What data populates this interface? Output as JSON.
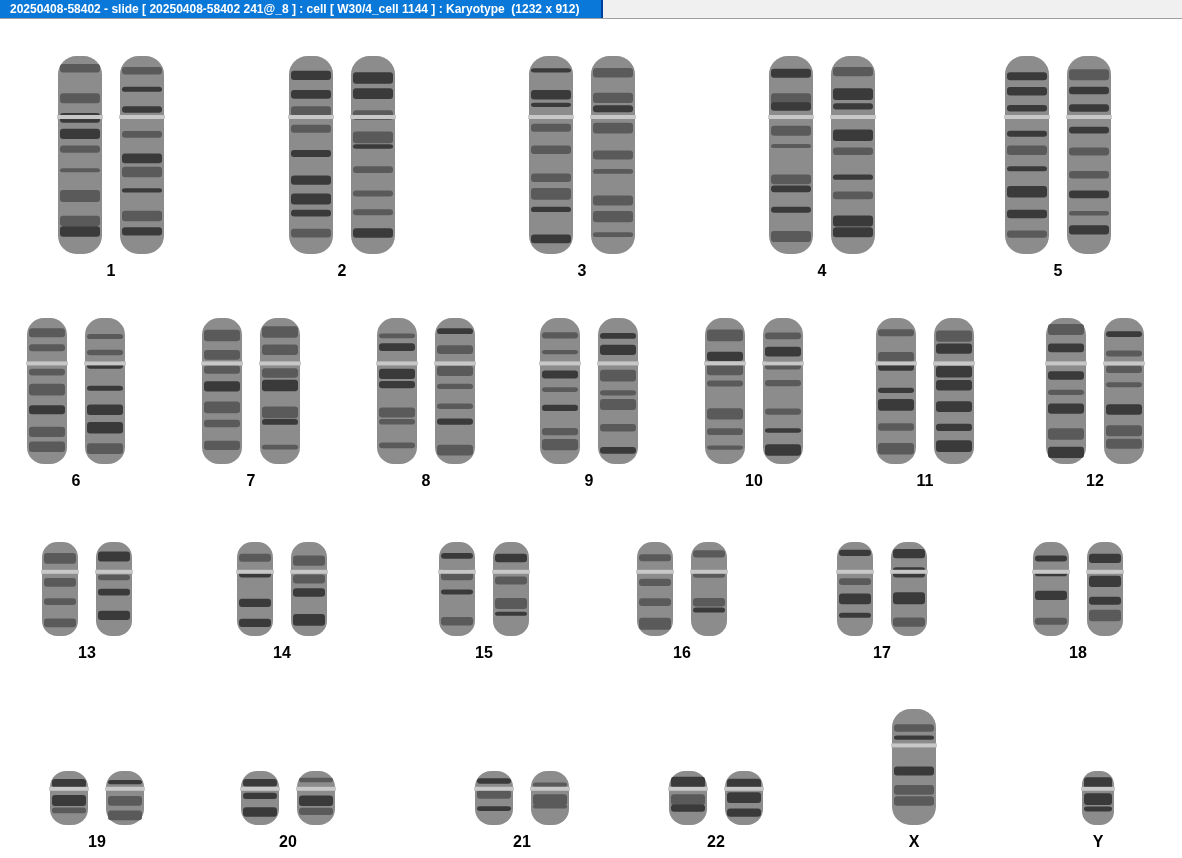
{
  "window": {
    "title": "20250408-58402 - slide [ 20250408-58402 241@_8 ] : cell [ W30/4_cell 1144 ] : Karyotype  (1232 x 912)"
  },
  "karyotype": {
    "rows": [
      {
        "groups": [
          {
            "label": "1",
            "kind": "pair"
          },
          {
            "label": "2",
            "kind": "pair"
          },
          {
            "label": "3",
            "kind": "pair"
          },
          {
            "label": "4",
            "kind": "pair"
          },
          {
            "label": "5",
            "kind": "pair"
          }
        ]
      },
      {
        "groups": [
          {
            "label": "6",
            "kind": "pair"
          },
          {
            "label": "7",
            "kind": "pair"
          },
          {
            "label": "8",
            "kind": "pair"
          },
          {
            "label": "9",
            "kind": "pair"
          },
          {
            "label": "10",
            "kind": "pair"
          },
          {
            "label": "11",
            "kind": "pair"
          },
          {
            "label": "12",
            "kind": "pair"
          }
        ]
      },
      {
        "groups": [
          {
            "label": "13",
            "kind": "pair"
          },
          {
            "label": "14",
            "kind": "pair"
          },
          {
            "label": "15",
            "kind": "pair"
          },
          {
            "label": "16",
            "kind": "pair"
          },
          {
            "label": "17",
            "kind": "pair"
          },
          {
            "label": "18",
            "kind": "pair"
          }
        ]
      },
      {
        "groups": [
          {
            "label": "19",
            "kind": "pair"
          },
          {
            "label": "20",
            "kind": "pair"
          },
          {
            "label": "21",
            "kind": "pair"
          },
          {
            "label": "22",
            "kind": "pair"
          },
          {
            "label": "X",
            "kind": "single"
          },
          {
            "label": "Y",
            "kind": "single"
          }
        ]
      }
    ]
  }
}
